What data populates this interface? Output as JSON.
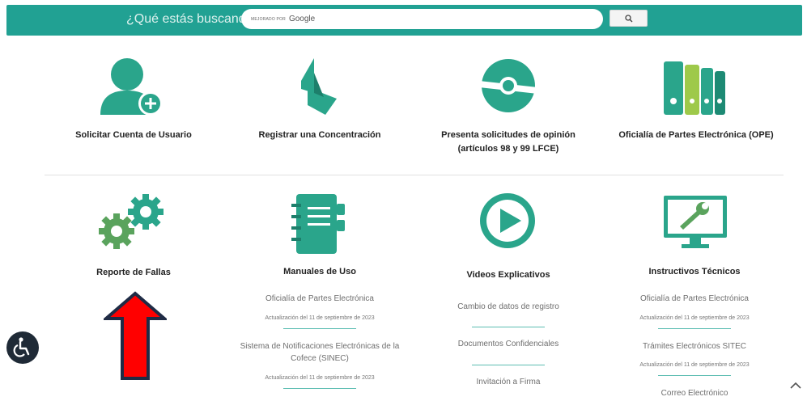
{
  "header": {
    "search_label": "¿Qué estás buscando?",
    "powered_by": "MEJORADO POR",
    "brand": "Google"
  },
  "tiles_top": [
    {
      "title": "Solicitar Cuenta de Usuario"
    },
    {
      "title": "Registrar una Concentración"
    },
    {
      "title": "Presenta solicitudes de opinión",
      "title_line2": "(artículos 98 y 99 LFCE)"
    },
    {
      "title": "Oficialía de Partes Electrónica (OPE)"
    }
  ],
  "tiles_bottom": [
    {
      "title": "Reporte de Fallas"
    },
    {
      "title": "Manuales de Uso",
      "links": [
        {
          "label": "Oficialía de Partes Electrónica",
          "date": "Actualización del 11 de septiembre de 2023"
        },
        {
          "label": "Sistema de Notificaciones Electrónicas de la",
          "label_line2": "Cofece (SINEC)",
          "date": "Actualización del 11 de septiembre de 2023"
        }
      ]
    },
    {
      "title": "Videos Explicativos",
      "links": [
        {
          "label": "Cambio de datos de registro"
        },
        {
          "label": "Documentos Confidenciales"
        },
        {
          "label": "Invitación a Firma"
        }
      ]
    },
    {
      "title": "Instructivos Técnicos",
      "links": [
        {
          "label": "Oficialía de Partes Electrónica",
          "date": "Actualización del 11 de septiembre de 2023"
        },
        {
          "label": "Trámites Electrónicos SITEC",
          "date": "Actualización del 11 de septiembre de 2023"
        },
        {
          "label": "Correo Electrónico"
        }
      ]
    }
  ],
  "colors": {
    "brand": "#21a193",
    "icon_green": "#2aa58b",
    "arrow_red": "#ff0000",
    "arrow_border": "#1f2b45"
  },
  "icons": [
    "search-icon",
    "user-add-icon",
    "concentration-logo-icon",
    "opinion-circle-icon",
    "binders-icon",
    "gears-icon",
    "notebook-icon",
    "play-video-icon",
    "monitor-wrench-icon",
    "accessibility-icon",
    "chevron-up-icon"
  ]
}
